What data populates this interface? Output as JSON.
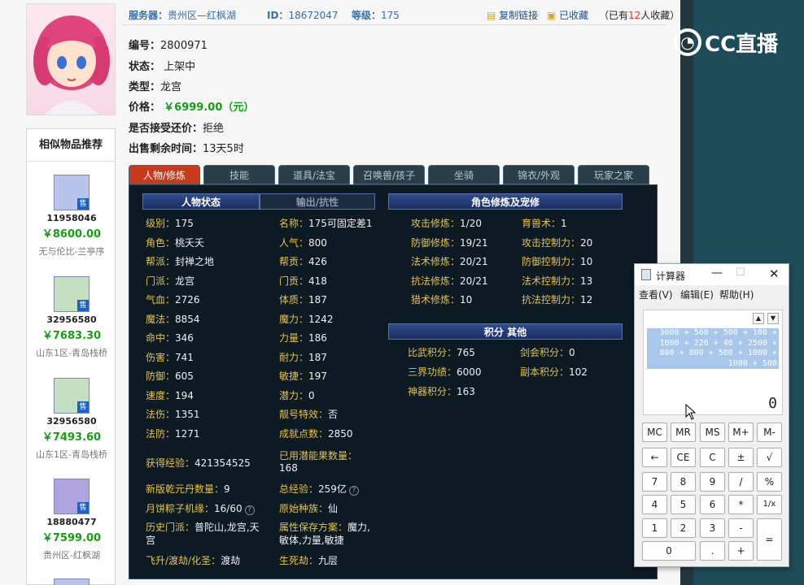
{
  "brand": {
    "name": "CC直播"
  },
  "info_bar": {
    "server_label": "服务器：",
    "server_value": "贵州区—红枫湖",
    "id_label": "ID：",
    "id_value": "18672047",
    "level_label": "等级：",
    "level_value": "175",
    "copy_link": "复制链接",
    "favorited": "已收藏",
    "fav_prefix": "（已有",
    "fav_count": "12",
    "fav_suffix": "人收藏）"
  },
  "item": {
    "number_label": "编号：",
    "number": "2800971",
    "status_label": "状态：",
    "status": "上架中",
    "type_label": "类型：",
    "type": "龙宫",
    "price_label": "价格：",
    "price": "￥6999.00（元）",
    "bargain_label": "是否接受还价：",
    "bargain": "拒绝",
    "remaining_label": "出售剩余时间：",
    "remaining": "13天5时"
  },
  "sidebar": {
    "title": "相似物品推荐",
    "sale_tag": "售",
    "items": [
      {
        "id": "11958046",
        "price": "￥8600.00",
        "server": "无与伦比-兰亭序"
      },
      {
        "id": "32956580",
        "price": "￥7683.30",
        "server": "山东1区-青岛栈桥"
      },
      {
        "id": "32956580",
        "price": "￥7493.60",
        "server": "山东1区-青岛栈桥"
      },
      {
        "id": "18880477",
        "price": "￥7599.00",
        "server": "贵州区-红枫湖"
      }
    ]
  },
  "tabs": [
    "人物/修炼",
    "技能",
    "道具/法宝",
    "召唤兽/孩子",
    "坐骑",
    "锦衣/外观",
    "玩家之家"
  ],
  "panel": {
    "status_header": "人物状态",
    "output_header": "输出/抗性",
    "cultivation_header": "角色修炼及宠修",
    "points_header": "积分 其他",
    "left_col": [
      {
        "k": "级别：",
        "v": "175"
      },
      {
        "k": "角色：",
        "v": "桃夭夭"
      },
      {
        "k": "帮派：",
        "v": "封禅之地"
      },
      {
        "k": "门派：",
        "v": "龙宫"
      },
      {
        "k": "气血：",
        "v": "2726"
      },
      {
        "k": "魔法：",
        "v": "8854"
      },
      {
        "k": "命中：",
        "v": "346"
      },
      {
        "k": "伤害：",
        "v": "741"
      },
      {
        "k": "防御：",
        "v": "605"
      },
      {
        "k": "速度：",
        "v": "194"
      },
      {
        "k": "法伤：",
        "v": "1351"
      },
      {
        "k": "法防：",
        "v": "1271"
      }
    ],
    "mid_col": [
      {
        "k": "名称：",
        "v": "175可固定差1"
      },
      {
        "k": "人气：",
        "v": "800"
      },
      {
        "k": "帮贡：",
        "v": "426"
      },
      {
        "k": "门贡：",
        "v": "418"
      },
      {
        "k": "体质：",
        "v": "187"
      },
      {
        "k": "魔力：",
        "v": "1242"
      },
      {
        "k": "力量：",
        "v": "186"
      },
      {
        "k": "耐力：",
        "v": "187"
      },
      {
        "k": "敏捷：",
        "v": "197"
      },
      {
        "k": "潜力：",
        "v": "0"
      },
      {
        "k": "靓号特效：",
        "v": "否"
      },
      {
        "k": "成就点数：",
        "v": "2850"
      }
    ],
    "exp_label": "获得经验：",
    "exp": "421354525",
    "used_fruit_label": "已用潜能果数量：",
    "used_fruit": "168",
    "qianyuan_label": "新版乾元丹数量：",
    "qianyuan": "9",
    "total_exp_label": "总经验：",
    "total_exp": "259亿",
    "zongzi_label": "月饼粽子机缘：",
    "zongzi": "16/60",
    "race_label": "原始种族：",
    "race": "仙",
    "history_label": "历史门派：",
    "history": "普陀山,龙宫,天宫",
    "attr_label": "属性保存方案：",
    "attr": "魔力,敏体,力量,敏捷",
    "ascend_label": "飞升/渡劫/化圣：",
    "ascend": "渡劫",
    "life_label": "生死劫：",
    "life": "九层",
    "cultivation": [
      {
        "k": "攻击修炼：",
        "v": "1/20",
        "k2": "育兽术：",
        "v2": "1"
      },
      {
        "k": "防御修炼：",
        "v": "19/21",
        "k2": "攻击控制力：",
        "v2": "20"
      },
      {
        "k": "法术修炼：",
        "v": "20/21",
        "k2": "防御控制力：",
        "v2": "10"
      },
      {
        "k": "抗法修炼：",
        "v": "20/21",
        "k2": "法术控制力：",
        "v2": "13"
      },
      {
        "k": "猎术修炼：",
        "v": "10",
        "k2": "抗法控制力：",
        "v2": "12"
      }
    ],
    "points": [
      {
        "k": "比武积分：",
        "v": "765",
        "k2": "剑会积分：",
        "v2": "0"
      },
      {
        "k": "三界功绩：",
        "v": "6000",
        "k2": "副本积分：",
        "v2": "102"
      },
      {
        "k": "神器积分：",
        "v": "163",
        "k2": "",
        "v2": ""
      }
    ]
  },
  "calculator": {
    "title": "计算器",
    "menu": [
      "查看(V)",
      "编辑(E)",
      "帮助(H)"
    ],
    "expression": [
      "3600 + 500 + 500 + 100 +",
      "1000 + 220 + 40 + 2500 +",
      "800 + 800 + 500 + 1000 +",
      "1000 + 500"
    ],
    "result": "0",
    "keys": [
      [
        "MC",
        "MR",
        "MS",
        "M+",
        "M-"
      ],
      [
        "←",
        "CE",
        "C",
        "±",
        "√"
      ],
      [
        "7",
        "8",
        "9",
        "/",
        "%"
      ],
      [
        "4",
        "5",
        "6",
        "*",
        "1/x"
      ],
      [
        "1",
        "2",
        "3",
        "-",
        "="
      ],
      [
        "0",
        ".",
        "+"
      ]
    ]
  }
}
